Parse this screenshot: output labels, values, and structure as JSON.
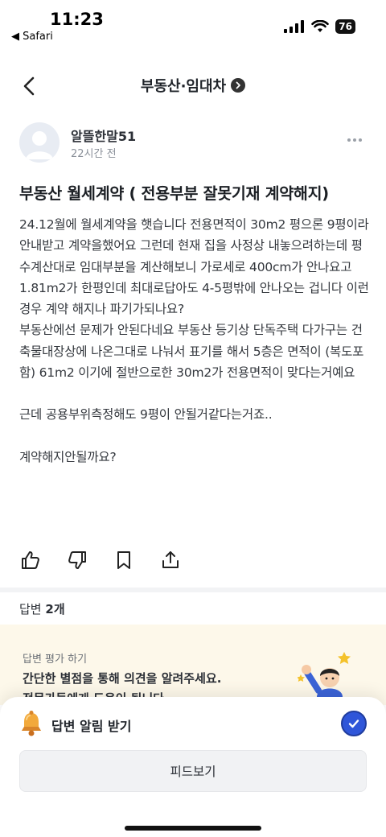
{
  "status": {
    "time": "11:23",
    "back_app": "◀ Safari",
    "battery": "76"
  },
  "nav": {
    "title": "부동산·임대차"
  },
  "post": {
    "author": "알뜰한말51",
    "time_ago": "22시간 전",
    "title": "부동산 월세계약 ( 전용부분 잘못기재 계약해지)",
    "paragraphs": [
      "24.12월에 월세계약을 햇습니다 전용면적이 30m2 평으론 9평이라 안내받고 계약을했어요 그런데 현재 집을 사정상 내놓으려하는데 평수계산대로 임대부분을 계산해보니 가로세로 400cm가 안나요고 1.81m2가 한평인데 최대로답아도 4-5평밖에 안나오는 겁니다 이런경우 계약 해지나 파기가되나요?",
      "부동산에선 문제가 안된다네요 부동산 등기상 단독주택 다가구는 건축물대장상에 나온그대로 나눠서 표기를 해서 5층은 면적이 (복도포함) 61m2 이기에 절반으로한 30m2가 전용면적이 맞다는거예요",
      "근데 공용부위측정해도 9평이 안될거같다는거죠..",
      "계약해지안될까요?"
    ]
  },
  "answers": {
    "label": "답변",
    "count": "2개"
  },
  "eval_card": {
    "subtitle": "답변 평가 하기",
    "line1": "간단한 별점을 통해 의견을 알려주세요.",
    "line2": "전문가들에게 도움이 됩니다."
  },
  "bottom_sheet": {
    "notify_label": "답변 알림 받기",
    "notify_checked": true,
    "feed_button": "피드보기"
  },
  "colors": {
    "accent": "#2f56d9",
    "eval_bg": "#fdf8ea"
  }
}
